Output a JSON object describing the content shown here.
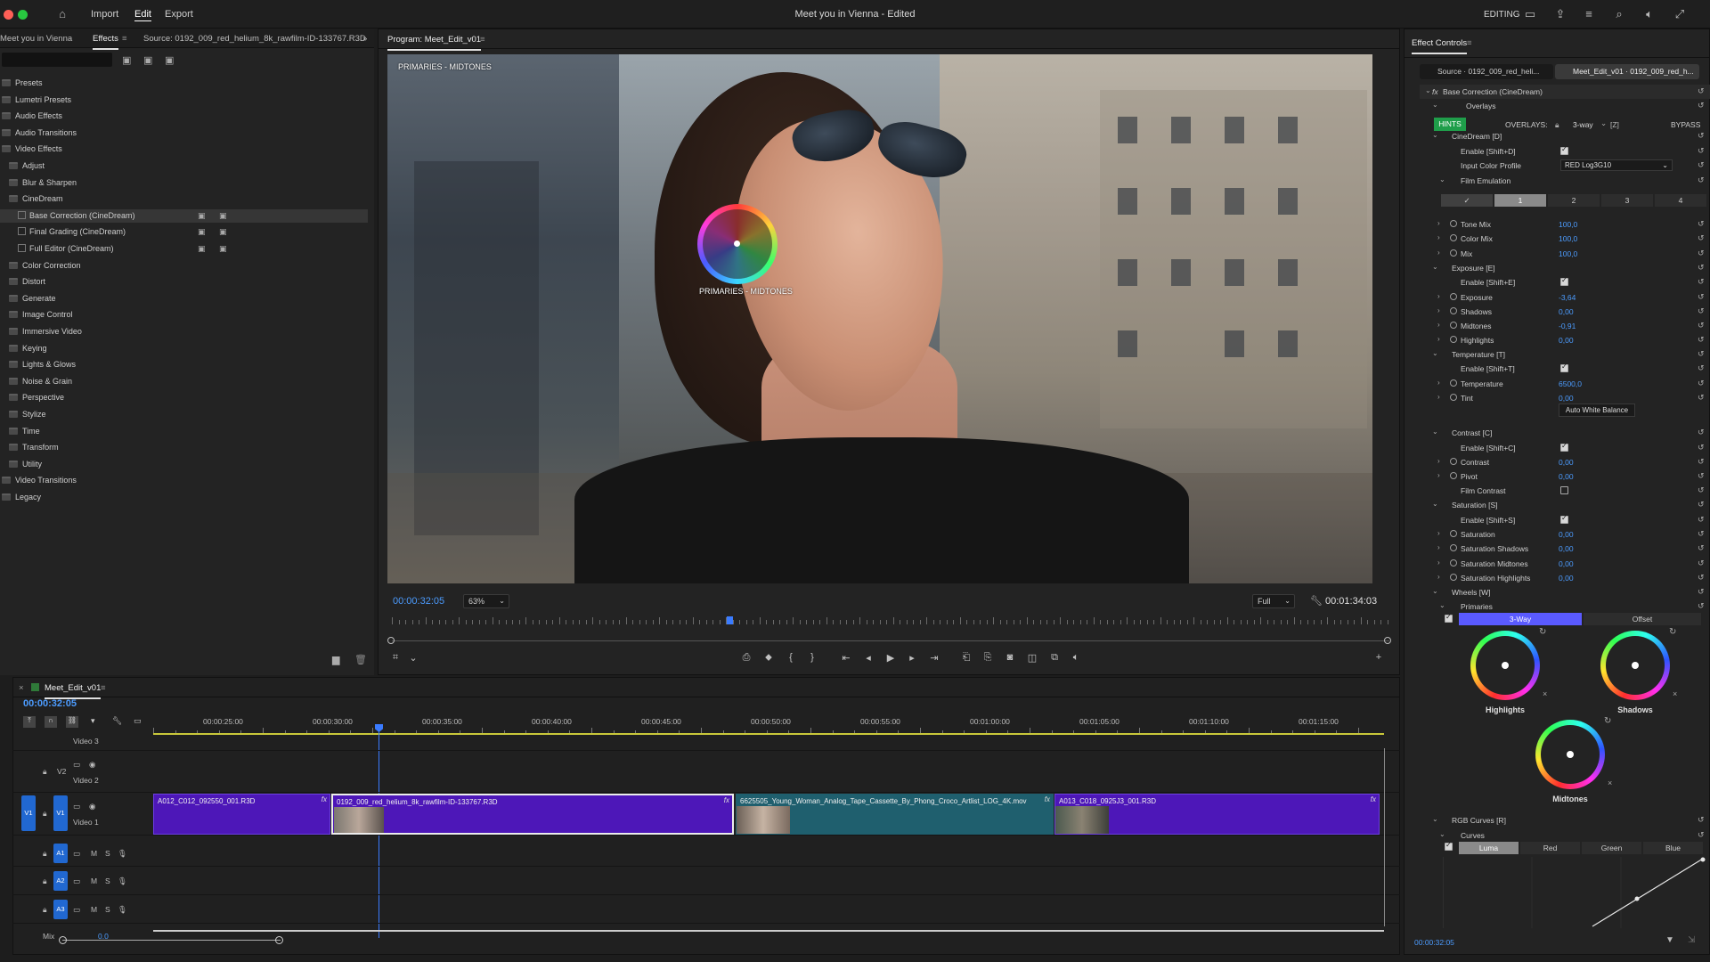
{
  "app": {
    "window_title": "Meet you in Vienna - Edited",
    "nav": [
      "Import",
      "Edit",
      "Export"
    ],
    "active_nav": "Edit",
    "workspace": "EDITING"
  },
  "left_panel": {
    "tabs": [
      "Meet you in Vienna",
      "Effects",
      "Source: 0192_009_red_helium_8k_rawfilm-ID-133767.R3D"
    ],
    "active_tab": "Effects",
    "tree": [
      {
        "label": "Presets",
        "indent": 0
      },
      {
        "label": "Lumetri Presets",
        "indent": 0
      },
      {
        "label": "Audio Effects",
        "indent": 0
      },
      {
        "label": "Audio Transitions",
        "indent": 0
      },
      {
        "label": "Video Effects",
        "indent": 0
      },
      {
        "label": "Adjust",
        "indent": 1
      },
      {
        "label": "Blur & Sharpen",
        "indent": 1
      },
      {
        "label": "CineDream",
        "indent": 1
      },
      {
        "label": "Base Correction (CineDream)",
        "indent": 2,
        "selected": true
      },
      {
        "label": "Final Grading (CineDream)",
        "indent": 2
      },
      {
        "label": "Full Editor (CineDream)",
        "indent": 2
      },
      {
        "label": "Color Correction",
        "indent": 1
      },
      {
        "label": "Distort",
        "indent": 1
      },
      {
        "label": "Generate",
        "indent": 1
      },
      {
        "label": "Image Control",
        "indent": 1
      },
      {
        "label": "Immersive Video",
        "indent": 1
      },
      {
        "label": "Keying",
        "indent": 1
      },
      {
        "label": "Lights & Glows",
        "indent": 1
      },
      {
        "label": "Noise & Grain",
        "indent": 1
      },
      {
        "label": "Perspective",
        "indent": 1
      },
      {
        "label": "Stylize",
        "indent": 1
      },
      {
        "label": "Time",
        "indent": 1
      },
      {
        "label": "Transform",
        "indent": 1
      },
      {
        "label": "Utility",
        "indent": 1
      },
      {
        "label": "Video Transitions",
        "indent": 0
      },
      {
        "label": "Legacy",
        "indent": 0
      }
    ]
  },
  "program_monitor": {
    "tab": "Program: Meet_Edit_v01",
    "overlay_label_top": "PRIMARIES - MIDTONES",
    "overlay_label_wheel": "PRIMARIES - MIDTONES",
    "current_time": "00:00:32:05",
    "zoom": "63%",
    "quality": "Full",
    "duration": "00:01:34:03"
  },
  "timeline": {
    "sequence_name": "Meet_Edit_v01",
    "current_time": "00:00:32:05",
    "ruler": [
      "00:00:25:00",
      "00:00:30:00",
      "00:00:35:00",
      "00:00:40:00",
      "00:00:45:00",
      "00:00:50:00",
      "00:00:55:00",
      "00:01:00:00",
      "00:01:05:00",
      "00:01:10:00",
      "00:01:15:00"
    ],
    "tracks": {
      "video3": "Video 3",
      "video2": "Video 2",
      "video1": "Video 1",
      "v2": "V2",
      "v1": "V1",
      "a1": "A1",
      "a2": "A2",
      "a3": "A3",
      "m": "M",
      "s": "S",
      "mix": "Mix",
      "mix_val": "0.0"
    },
    "clips": [
      {
        "name": "A012_C012_092550_001.R3D",
        "color": "#4d17b8"
      },
      {
        "name": "0192_009_red_helium_8k_rawfilm-ID-133767.R3D",
        "color": "#4d17b8"
      },
      {
        "name": "6625505_Young_Woman_Analog_Tape_Cassette_By_Phong_Croco_Artlist_LOG_4K.mov",
        "color": "#1f5f6e"
      },
      {
        "name": "A013_C018_0925J3_001.R3D",
        "color": "#4d17b8"
      }
    ]
  },
  "effect_controls": {
    "title": "Effect Controls",
    "source_tab": "Source · 0192_009_red_heli...",
    "seq_tab": "Meet_Edit_v01 · 0192_009_red_h...",
    "fx_name": "Base Correction (CineDream)",
    "overlays_label": "Overlays",
    "hints": "HINTS",
    "overlays_caps": "OVERLAYS:",
    "overlay_mode": "3-way",
    "overlay_key": "[Z]",
    "bypass": "BYPASS",
    "cinedream": "CineDream [D]",
    "enable_d": "Enable [Shift+D]",
    "input_profile_label": "Input Color Profile",
    "input_profile": "RED Log3G10",
    "film_emulation": "Film Emulation",
    "fe_tabs": [
      "✓",
      "1",
      "2",
      "3",
      "4"
    ],
    "tone_mix": {
      "label": "Tone Mix",
      "value": "100,0"
    },
    "color_mix": {
      "label": "Color Mix",
      "value": "100,0"
    },
    "mix": {
      "label": "Mix",
      "value": "100,0"
    },
    "exposure_section": "Exposure [E]",
    "enable_e": "Enable [Shift+E]",
    "exposure": {
      "label": "Exposure",
      "value": "-3,64"
    },
    "shadows": {
      "label": "Shadows",
      "value": "0,00"
    },
    "midtones": {
      "label": "Midtones",
      "value": "-0,91"
    },
    "highlights": {
      "label": "Highlights",
      "value": "0,00"
    },
    "temperature_section": "Temperature [T]",
    "enable_t": "Enable [Shift+T]",
    "temperature": {
      "label": "Temperature",
      "value": "6500,0"
    },
    "tint": {
      "label": "Tint",
      "value": "0,00"
    },
    "awb": "Auto White Balance",
    "contrast_section": "Contrast [C]",
    "enable_c": "Enable [Shift+C]",
    "contrast": {
      "label": "Contrast",
      "value": "0,00"
    },
    "pivot": {
      "label": "Pivot",
      "value": "0,00"
    },
    "film_contrast": "Film Contrast",
    "saturation_section": "Saturation [S]",
    "enable_s": "Enable [Shift+S]",
    "saturation": {
      "label": "Saturation",
      "value": "0,00"
    },
    "sat_shadows": {
      "label": "Saturation Shadows",
      "value": "0,00"
    },
    "sat_midtones": {
      "label": "Saturation Midtones",
      "value": "0,00"
    },
    "sat_highlights": {
      "label": "Saturation Highlights",
      "value": "0,00"
    },
    "wheels_section": "Wheels [W]",
    "primaries": "Primaries",
    "wheel_mode_a": "3-Way",
    "wheel_mode_b": "Offset",
    "wheel_highlights": "Highlights",
    "wheel_shadows": "Shadows",
    "wheel_midtones": "Midtones",
    "rgb_curves": "RGB Curves [R]",
    "curves": "Curves",
    "curve_tabs": [
      "Luma",
      "Red",
      "Green",
      "Blue"
    ],
    "footer_time": "00:00:32:05"
  }
}
